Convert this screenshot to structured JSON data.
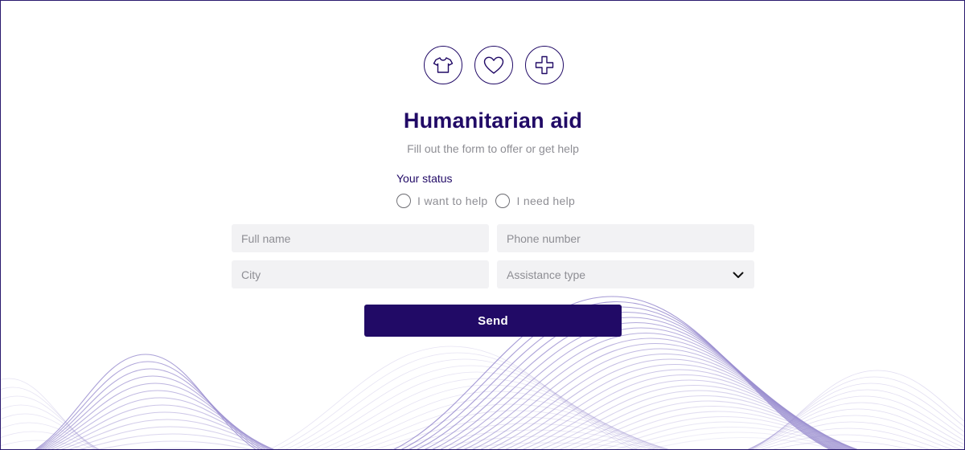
{
  "theme": {
    "accent": "#210a66",
    "field_bg": "#f2f2f4",
    "muted_text": "#8e8e94",
    "wave_color": "#9b8fd0"
  },
  "icons": [
    "t-shirt-icon",
    "heart-icon",
    "medical-cross-icon"
  ],
  "header": {
    "title": "Humanitarian aid",
    "subtitle": "Fill out the form to offer or get help"
  },
  "status": {
    "label": "Your status",
    "options": [
      {
        "label": "I want to help",
        "selected": false
      },
      {
        "label": "I need help",
        "selected": false
      }
    ]
  },
  "form": {
    "full_name_placeholder": "Full name",
    "phone_placeholder": "Phone number",
    "city_placeholder": "City",
    "assistance_placeholder": "Assistance type"
  },
  "actions": {
    "send_label": "Send"
  }
}
